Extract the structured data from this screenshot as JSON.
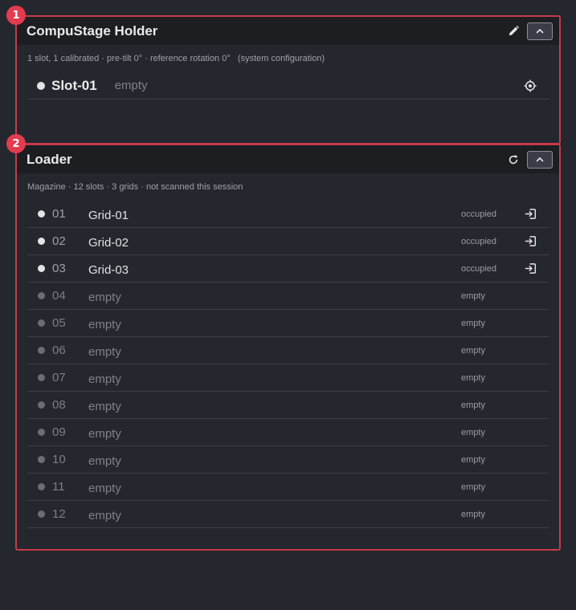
{
  "panels": {
    "holder": {
      "badge": "1",
      "title": "CompuStage Holder",
      "subtitle": "1 slot, 1 calibrated · pre-tilt 0° · reference rotation 0°   (system configuration)",
      "header_icons": [
        "pencil-icon",
        "chevron-up-icon"
      ],
      "slot": {
        "name": "Slot-01",
        "status": "empty",
        "indicator": "on",
        "action_icon": "target-icon"
      }
    },
    "loader": {
      "badge": "2",
      "title": "Loader",
      "subtitle": "Magazine · 12 slots · 3 grids · not scanned this session",
      "header_icons": [
        "refresh-icon",
        "chevron-up-icon"
      ],
      "rows": [
        {
          "num": "01",
          "label": "Grid-01",
          "state": "occupied",
          "occupied": true
        },
        {
          "num": "02",
          "label": "Grid-02",
          "state": "occupied",
          "occupied": true
        },
        {
          "num": "03",
          "label": "Grid-03",
          "state": "occupied",
          "occupied": true
        },
        {
          "num": "04",
          "label": "empty",
          "state": "empty",
          "occupied": false
        },
        {
          "num": "05",
          "label": "empty",
          "state": "empty",
          "occupied": false
        },
        {
          "num": "06",
          "label": "empty",
          "state": "empty",
          "occupied": false
        },
        {
          "num": "07",
          "label": "empty",
          "state": "empty",
          "occupied": false
        },
        {
          "num": "08",
          "label": "empty",
          "state": "empty",
          "occupied": false
        },
        {
          "num": "09",
          "label": "empty",
          "state": "empty",
          "occupied": false
        },
        {
          "num": "10",
          "label": "empty",
          "state": "empty",
          "occupied": false
        },
        {
          "num": "11",
          "label": "empty",
          "state": "empty",
          "occupied": false
        },
        {
          "num": "12",
          "label": "empty",
          "state": "empty",
          "occupied": false
        }
      ]
    }
  },
  "colors": {
    "background": "#25272e",
    "header_bg": "#1c1e22",
    "highlight_border": "#c73a4a",
    "badge": "#e33b50",
    "row_divider": "#3c3f47"
  }
}
